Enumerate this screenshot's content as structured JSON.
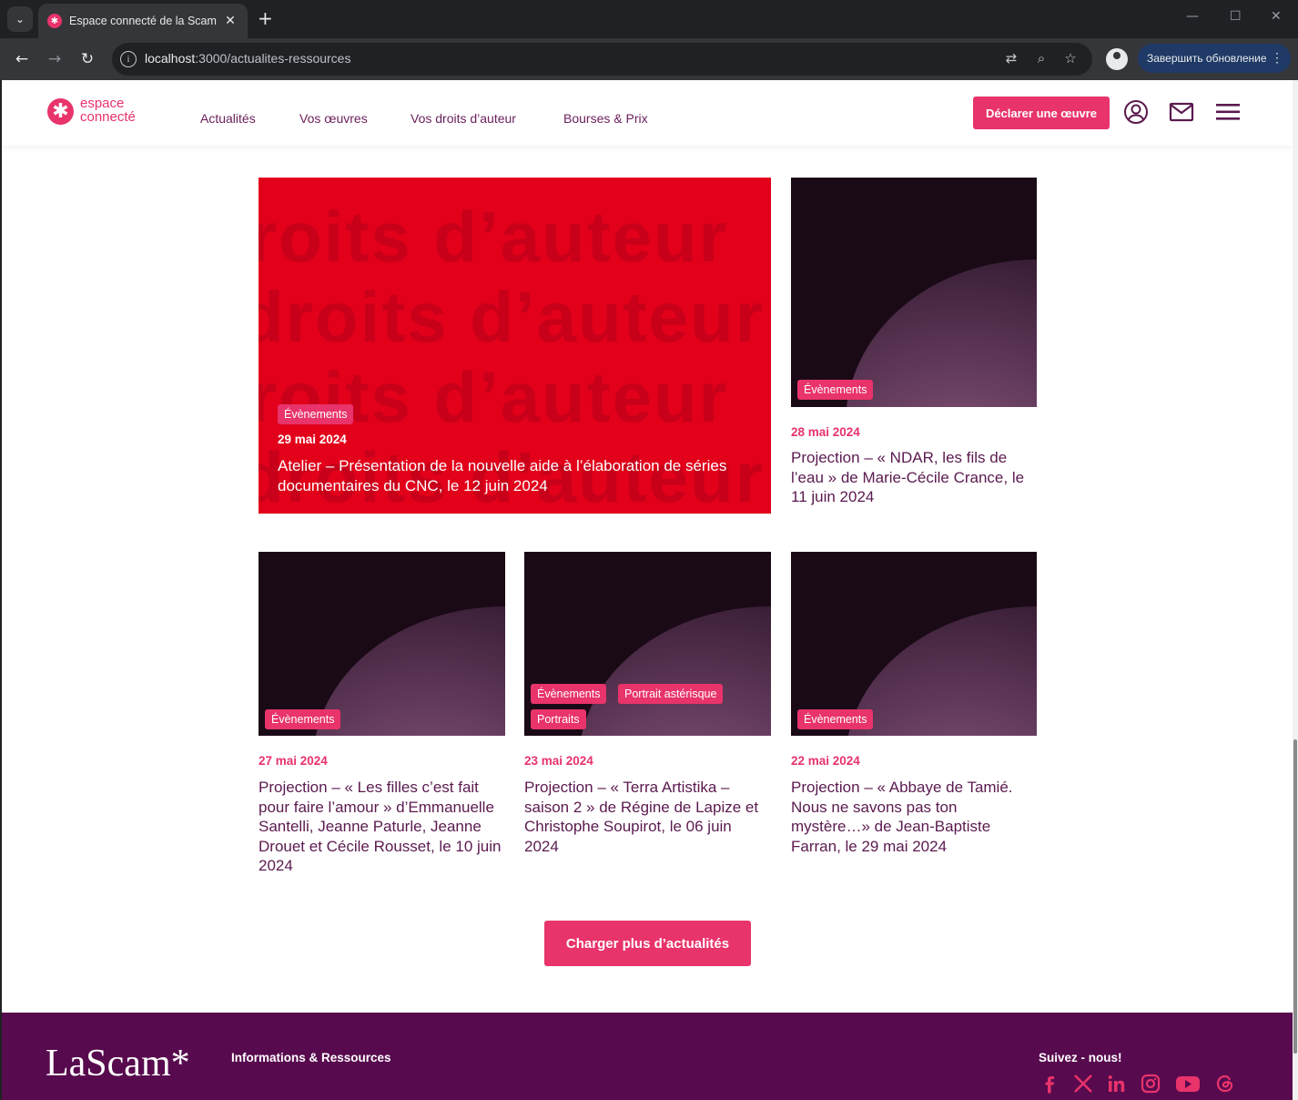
{
  "browser": {
    "tab_title": "Espace connecté de la Scam",
    "url_host": "localhost",
    "url_path": ":3000/actualites-ressources",
    "update_label": "Завершить обновление"
  },
  "header": {
    "logo_line1": "espace",
    "logo_line2": "connecté",
    "nav": [
      "Actualités",
      "Vos œuvres",
      "Vos droits d’auteur",
      "Bourses & Prix"
    ],
    "declare_label": "Déclarer une œuvre"
  },
  "hero": {
    "bg_word": "droits d’auteur",
    "tag": "Évènements",
    "date": "29 mai 2024",
    "title": "Atelier – Présentation de la nouvelle aide à l’élaboration de séries documentaires du CNC, le 12 juin 2024"
  },
  "cards": [
    {
      "tags": [
        "Évènements"
      ],
      "date": "28 mai 2024",
      "title": "Projection – « NDAR, les fils de l’eau » de Marie-Cécile Crance, le 11 juin 2024"
    },
    {
      "tags": [
        "Évènements"
      ],
      "date": "27 mai 2024",
      "title": "Projection – « Les filles c’est fait pour faire l’amour » d’Emmanuelle Santelli, Jeanne Paturle, Jeanne Drouet et Cécile Rousset, le 10 juin 2024"
    },
    {
      "tags": [
        "Évènements",
        "Portrait astérisque",
        "Portraits"
      ],
      "date": "23 mai 2024",
      "title": "Projection – « Terra Artistika – saison 2 » de Régine de Lapize et Christophe Soupirot, le 06 juin 2024"
    },
    {
      "tags": [
        "Évènements"
      ],
      "date": "22 mai 2024",
      "title": "Projection – « Abbaye de Tamié. Nous ne savons pas ton mystère…» de Jean-Baptiste Farran, le 29 mai 2024"
    }
  ],
  "load_more_label": "Charger plus d’actualités",
  "footer": {
    "logo": "LaScam*",
    "section_title": "Informations & Ressources",
    "follow_title": "Suivez - nous!",
    "social": [
      "facebook-icon",
      "x-icon",
      "linkedin-icon",
      "instagram-icon",
      "youtube-icon",
      "threads-icon"
    ]
  },
  "colors": {
    "brand_pink": "#e8336b",
    "brand_purple": "#580a4e",
    "hero_red": "#e2001a"
  }
}
